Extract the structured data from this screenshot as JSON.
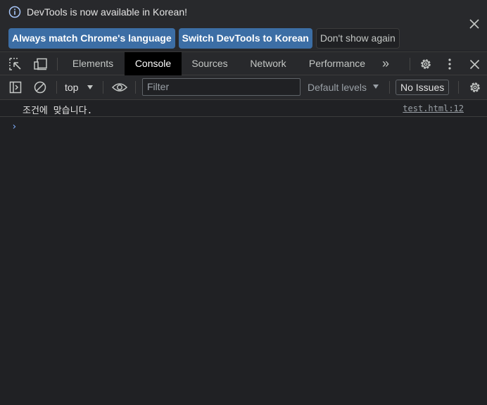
{
  "infobar": {
    "message": "DevTools is now available in Korean!",
    "buttons": {
      "match": "Always match Chrome's language",
      "switch": "Switch DevTools to Korean",
      "dismiss": "Don't show again"
    }
  },
  "tabs": {
    "elements": "Elements",
    "console": "Console",
    "sources": "Sources",
    "network": "Network",
    "performance": "Performance",
    "more": "»"
  },
  "toolbar": {
    "context": "top",
    "filter_placeholder": "Filter",
    "levels": "Default levels",
    "issues": "No Issues"
  },
  "console": {
    "messages": [
      {
        "text": "조건에 맞습니다.",
        "source": "test.html:12"
      }
    ],
    "prompt_symbol": "›"
  },
  "colors": {
    "background": "#202124",
    "toolbar": "#28292c",
    "primary_button": "#3c6ea5",
    "prompt": "#7cacf8"
  }
}
